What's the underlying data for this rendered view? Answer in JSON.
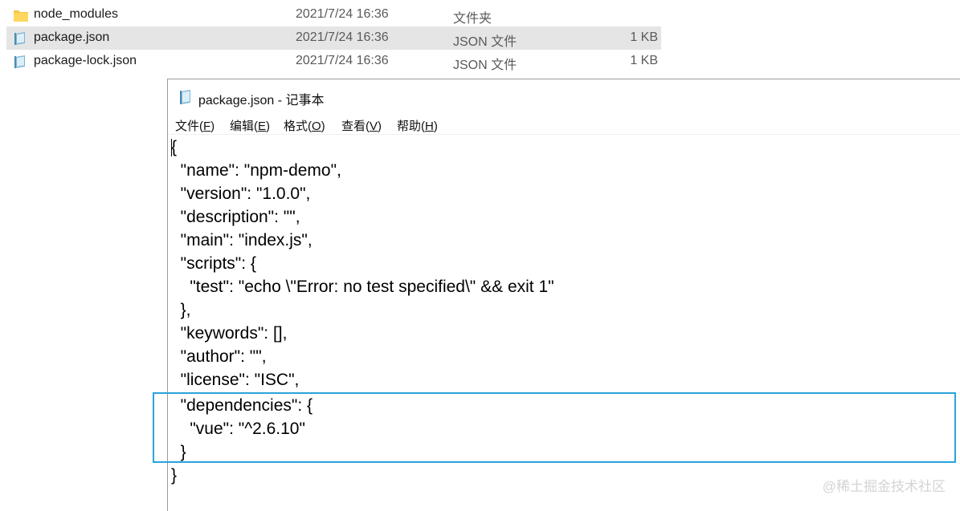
{
  "explorer": {
    "files": [
      {
        "name": "node_modules",
        "date": "2021/7/24 16:36",
        "type": "文件夹",
        "size": "",
        "icon": "folder-icon",
        "selected": false
      },
      {
        "name": "package.json",
        "date": "2021/7/24 16:36",
        "type": "JSON 文件",
        "size": "1 KB",
        "icon": "notepad-file-icon",
        "selected": true
      },
      {
        "name": "package-lock.json",
        "date": "2021/7/24 16:36",
        "type": "JSON 文件",
        "size": "1 KB",
        "icon": "notepad-file-icon",
        "selected": false
      }
    ]
  },
  "notepad": {
    "title": "package.json - 记事本",
    "menu": [
      {
        "label": "文件(",
        "key": "F",
        "end": ")"
      },
      {
        "label": "编辑(",
        "key": "E",
        "end": ")"
      },
      {
        "label": "格式(",
        "key": "O",
        "end": ")"
      },
      {
        "label": "查看(",
        "key": "V",
        "end": ")"
      },
      {
        "label": "帮助(",
        "key": "H",
        "end": ")"
      }
    ],
    "lines": [
      "{",
      "  \"name\": \"npm-demo\",",
      "  \"version\": \"1.0.0\",",
      "  \"description\": \"\",",
      "  \"main\": \"index.js\",",
      "  \"scripts\": {",
      "    \"test\": \"echo \\\"Error: no test specified\\\" && exit 1\"",
      "  },",
      "  \"keywords\": [],",
      "  \"author\": \"\",",
      "  \"license\": \"ISC\",",
      "  \"dependencies\": {",
      "    \"vue\": \"^2.6.10\"",
      "  }",
      "}"
    ]
  },
  "watermark": "@稀土掘金技术社区",
  "colors": {
    "selection": "#e5e5e5",
    "highlight_border": "#2aa3d9",
    "folder": "#f3c544"
  }
}
